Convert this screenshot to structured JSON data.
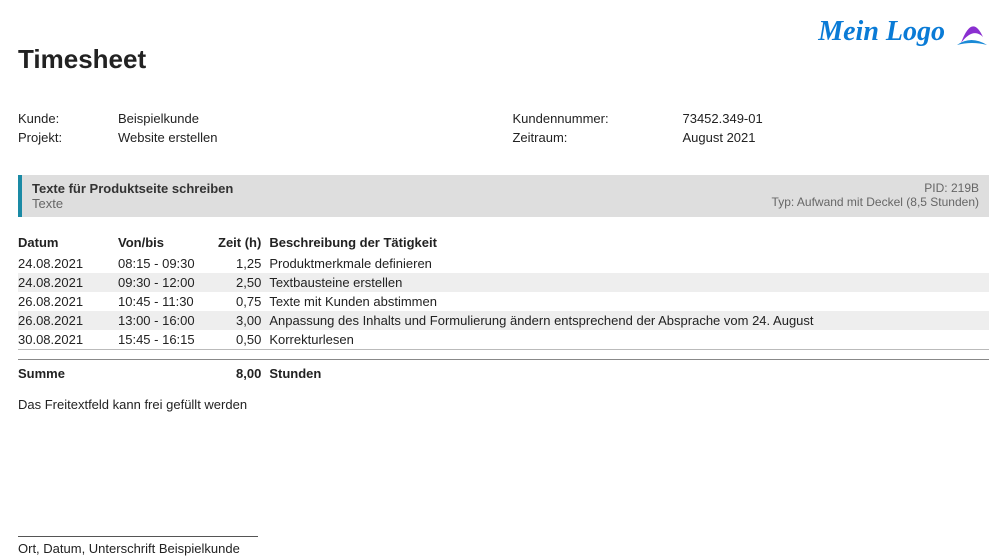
{
  "title": "Timesheet",
  "logo_text": "Mein Logo",
  "info": {
    "kunde_label": "Kunde:",
    "kunde_value": "Beispielkunde",
    "projekt_label": "Projekt:",
    "projekt_value": "Website erstellen",
    "knr_label": "Kundennummer:",
    "knr_value": "73452.349-01",
    "zeitraum_label": "Zeitraum:",
    "zeitraum_value": "August 2021"
  },
  "task": {
    "title": "Texte für Produktseite schreiben",
    "subtitle": "Texte",
    "pid": "PID: 219B",
    "typ": "Typ: Aufwand mit Deckel (8,5 Stunden)"
  },
  "table": {
    "headers": {
      "datum": "Datum",
      "vonbis": "Von/bis",
      "zeit": "Zeit (h)",
      "besch": "Beschreibung der Tätigkeit"
    },
    "rows": [
      {
        "datum": "24.08.2021",
        "vonbis": "08:15 - 09:30",
        "zeit": "1,25",
        "besch": "Produktmerkmale definieren"
      },
      {
        "datum": "24.08.2021",
        "vonbis": "09:30 - 12:00",
        "zeit": "2,50",
        "besch": "Textbausteine erstellen"
      },
      {
        "datum": "26.08.2021",
        "vonbis": "10:45 - 11:30",
        "zeit": "0,75",
        "besch": "Texte mit Kunden abstimmen"
      },
      {
        "datum": "26.08.2021",
        "vonbis": "13:00 - 16:00",
        "zeit": "3,00",
        "besch": "Anpassung des Inhalts und Formulierung ändern entsprechend der Absprache vom 24. August"
      },
      {
        "datum": "30.08.2021",
        "vonbis": "15:45 - 16:15",
        "zeit": "0,50",
        "besch": "Korrekturlesen"
      }
    ],
    "sum": {
      "label": "Summe",
      "zeit": "8,00",
      "unit": "Stunden"
    }
  },
  "freetext": "Das Freitextfeld kann frei gefüllt werden",
  "signature": "Ort, Datum, Unterschrift Beispielkunde"
}
